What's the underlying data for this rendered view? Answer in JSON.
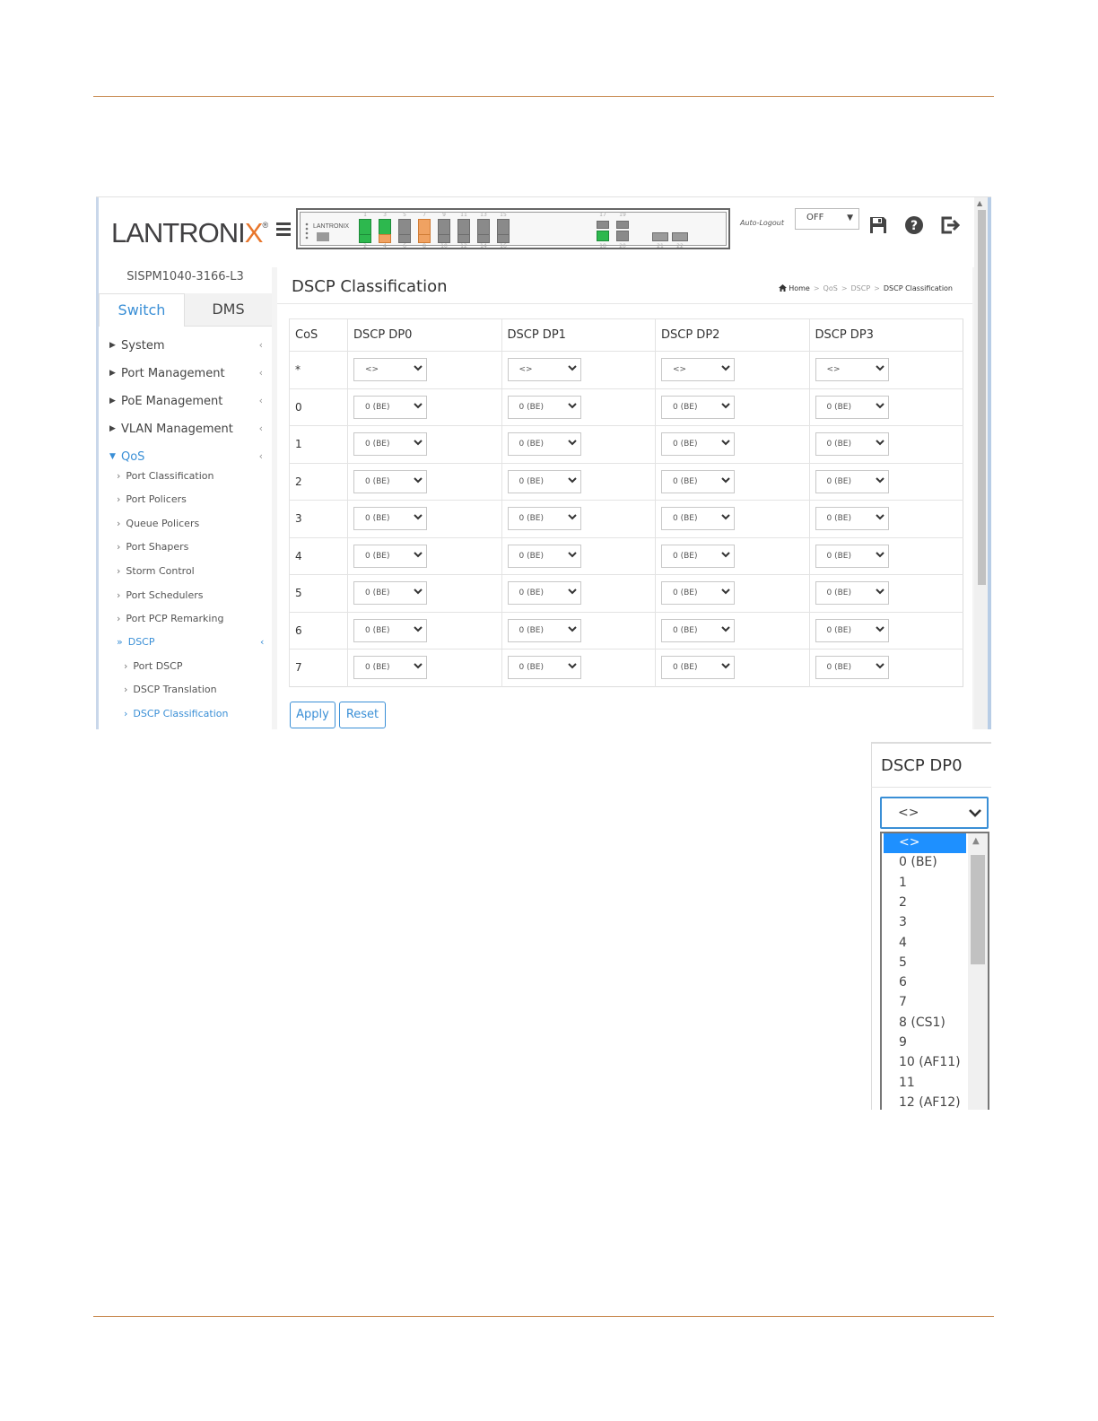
{
  "header": {
    "logo_text": "LANTRONIX",
    "logo_mark": "®",
    "autologout_label": "Auto-Logout",
    "autologout_value": "OFF"
  },
  "switch_panel": {
    "brand": "LANTRONIX",
    "top_port_numbers": [
      "1",
      "3",
      "5",
      "7",
      "9",
      "11",
      "13",
      "15",
      "17",
      "19"
    ],
    "bottom_port_numbers": [
      "2",
      "4",
      "6",
      "8",
      "10",
      "12",
      "14",
      "16",
      "18",
      "20",
      "21",
      "22"
    ]
  },
  "sidebar": {
    "device_name": "SISPM1040-3166-L3",
    "tabs": [
      "Switch",
      "DMS"
    ],
    "menu": [
      "System",
      "Port Management",
      "PoE Management",
      "VLAN Management",
      "QoS"
    ],
    "qos_items": [
      "Port Classification",
      "Port Policers",
      "Queue Policers",
      "Port Shapers",
      "Storm Control",
      "Port Schedulers",
      "Port PCP Remarking",
      "DSCP"
    ],
    "dscp_items": [
      "Port DSCP",
      "DSCP Translation",
      "DSCP Classification"
    ]
  },
  "page": {
    "title": "DSCP Classification",
    "breadcrumb": [
      "Home",
      "QoS",
      "DSCP",
      "DSCP Classification"
    ]
  },
  "table": {
    "headers": [
      "CoS",
      "DSCP DP0",
      "DSCP DP1",
      "DSCP DP2",
      "DSCP DP3"
    ],
    "rows": [
      {
        "cos": "*",
        "values": [
          "<>",
          "<>",
          "<>",
          "<>"
        ]
      },
      {
        "cos": "0",
        "values": [
          "0 (BE)",
          "0 (BE)",
          "0 (BE)",
          "0 (BE)"
        ]
      },
      {
        "cos": "1",
        "values": [
          "0 (BE)",
          "0 (BE)",
          "0 (BE)",
          "0 (BE)"
        ]
      },
      {
        "cos": "2",
        "values": [
          "0 (BE)",
          "0 (BE)",
          "0 (BE)",
          "0 (BE)"
        ]
      },
      {
        "cos": "3",
        "values": [
          "0 (BE)",
          "0 (BE)",
          "0 (BE)",
          "0 (BE)"
        ]
      },
      {
        "cos": "4",
        "values": [
          "0 (BE)",
          "0 (BE)",
          "0 (BE)",
          "0 (BE)"
        ]
      },
      {
        "cos": "5",
        "values": [
          "0 (BE)",
          "0 (BE)",
          "0 (BE)",
          "0 (BE)"
        ]
      },
      {
        "cos": "6",
        "values": [
          "0 (BE)",
          "0 (BE)",
          "0 (BE)",
          "0 (BE)"
        ]
      },
      {
        "cos": "7",
        "values": [
          "0 (BE)",
          "0 (BE)",
          "0 (BE)",
          "0 (BE)"
        ]
      }
    ]
  },
  "buttons": {
    "apply": "Apply",
    "reset": "Reset"
  },
  "inset": {
    "header": "DSCP DP0",
    "selected_value": "<>",
    "options": [
      "<>",
      "0 (BE)",
      "1",
      "2",
      "3",
      "4",
      "5",
      "6",
      "7",
      "8 (CS1)",
      "9",
      "10 (AF11)",
      "11",
      "12 (AF12)"
    ]
  },
  "colors": {
    "accent": "#3a8fd6",
    "rule": "#c98d55",
    "port_link": "#2db84e",
    "port_poe": "#f0a262",
    "option_highlight": "#1e90ff"
  },
  "icons": [
    "hamburger-icon",
    "save-icon",
    "help-icon",
    "logout-icon",
    "home-icon",
    "chevron-down-icon"
  ]
}
